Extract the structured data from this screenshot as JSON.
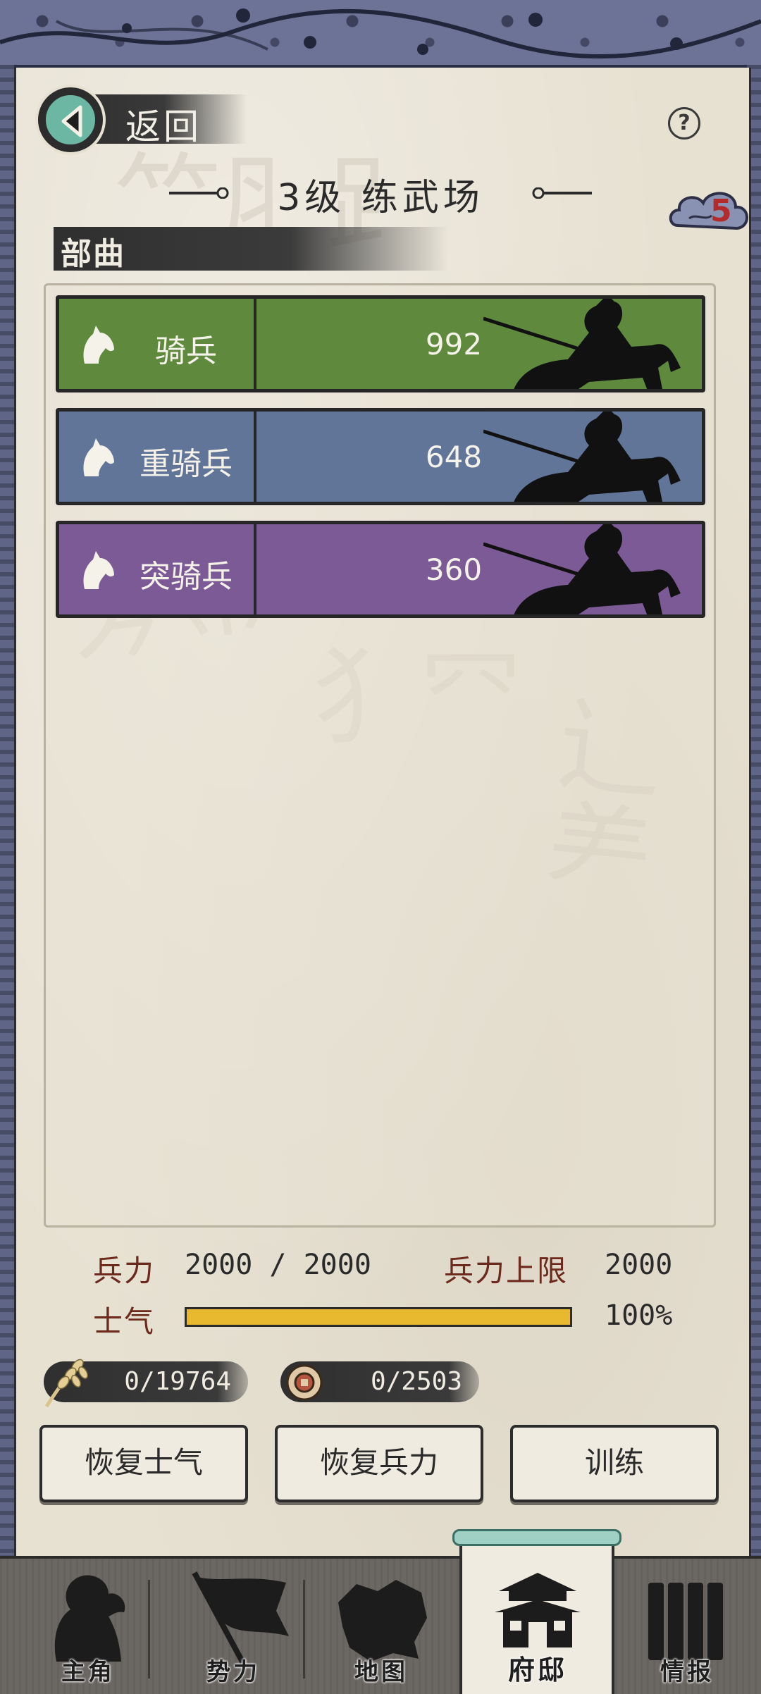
{
  "header": {
    "back_label": "返回",
    "help_symbol": "?",
    "title": "3级 练武场",
    "badge_count": "5"
  },
  "section": {
    "title": "部曲"
  },
  "units": [
    {
      "name": "骑兵",
      "count": "992",
      "color": "#5f8a3e",
      "icon": "horse-icon"
    },
    {
      "name": "重骑兵",
      "count": "648",
      "color": "#617599",
      "icon": "horse-icon"
    },
    {
      "name": "突骑兵",
      "count": "360",
      "color": "#7b5a95",
      "icon": "horse-icon"
    }
  ],
  "stats": {
    "troops_label": "兵力",
    "troops_value": "2000 / 2000",
    "cap_label": "兵力上限",
    "cap_value": "2000",
    "morale_label": "士气",
    "morale_value": "100%",
    "morale_fraction": 1.0
  },
  "resources": {
    "grain": {
      "value": "0/19764",
      "icon": "wheat-icon"
    },
    "coin": {
      "value": "0/2503",
      "icon": "coin-icon"
    }
  },
  "actions": {
    "restore_morale": "恢复士气",
    "restore_troops": "恢复兵力",
    "train": "训练"
  },
  "nav": {
    "items": [
      {
        "label": "主角",
        "icon": "hero-icon"
      },
      {
        "label": "势力",
        "icon": "flag-icon"
      },
      {
        "label": "地图",
        "icon": "map-icon"
      },
      {
        "label": "府邸",
        "icon": "mansion-icon",
        "active": true
      },
      {
        "label": "情报",
        "icon": "intel-icon"
      }
    ]
  },
  "colors": {
    "accent_teal": "#6cb6a4",
    "morale_bar": "#e8b92e",
    "stat_label": "#6b2a1c"
  }
}
